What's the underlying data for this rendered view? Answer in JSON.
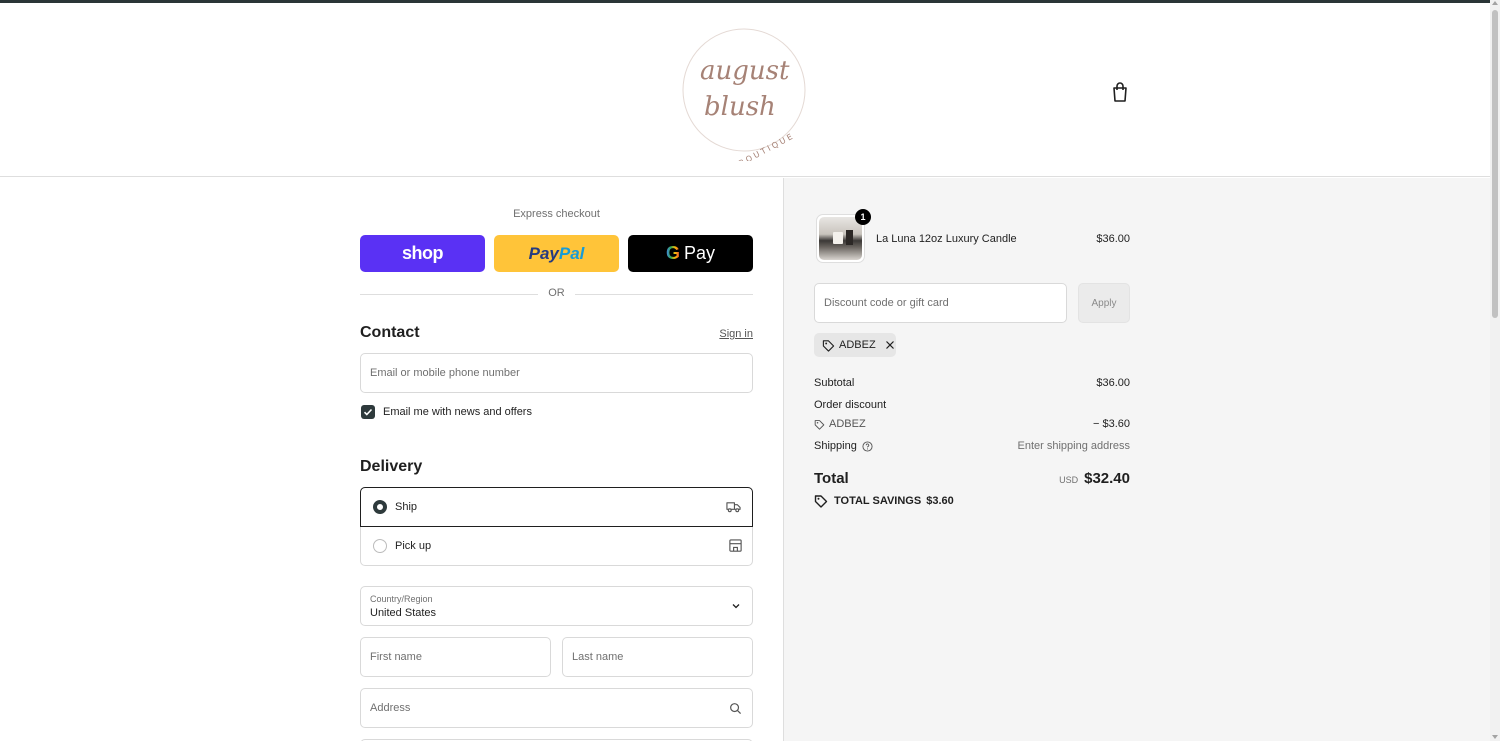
{
  "brand": {
    "logo_text_script_1": "august",
    "logo_text_script_2": "blush",
    "logo_text_sub": "BOUTIQUE",
    "icon": "shopping-bag-icon"
  },
  "express": {
    "label": "Express checkout",
    "shop_label": "shop",
    "paypal_label_1": "Pay",
    "paypal_label_2": "Pal",
    "gpay_g": "G",
    "gpay_label": "Pay",
    "or_label": "OR",
    "colors": {
      "shop": "#5a31f4",
      "paypal": "#ffc439",
      "gpay": "#000000"
    }
  },
  "contact": {
    "title": "Contact",
    "signin_label": "Sign in",
    "email_placeholder": "Email or mobile phone number",
    "email_value": "",
    "news_label": "Email me with news and offers",
    "news_checked": true
  },
  "delivery": {
    "title": "Delivery",
    "options": [
      {
        "label": "Ship",
        "selected": true,
        "icon": "truck-icon"
      },
      {
        "label": "Pick up",
        "selected": false,
        "icon": "store-icon"
      }
    ],
    "country_label": "Country/Region",
    "country_value": "United States",
    "first_name_placeholder": "First name",
    "last_name_placeholder": "Last name",
    "address_placeholder": "Address"
  },
  "summary": {
    "item": {
      "name": "La Luna 12oz Luxury Candle",
      "price": "$36.00",
      "qty": "1"
    },
    "discount_placeholder": "Discount code or gift card",
    "apply_label": "Apply",
    "applied_code": "ADBEZ",
    "subtotal_label": "Subtotal",
    "subtotal_value": "$36.00",
    "order_discount_label": "Order discount",
    "discount_code": "ADBEZ",
    "discount_value": "− $3.60",
    "shipping_label": "Shipping",
    "shipping_value": "Enter shipping address",
    "total_label": "Total",
    "total_currency": "USD",
    "total_value": "$32.40",
    "savings_label": "TOTAL SAVINGS",
    "savings_value": "$3.60"
  }
}
